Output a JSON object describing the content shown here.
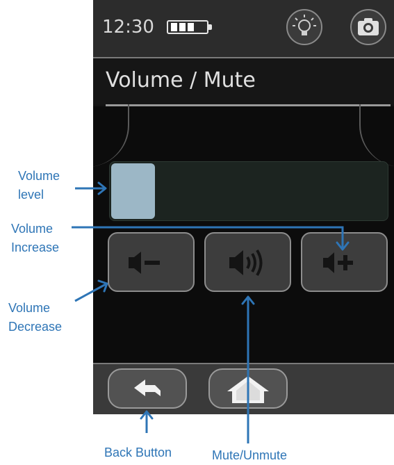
{
  "status_bar": {
    "time": "12:30",
    "battery_icon": "battery-icon",
    "light_icon": "lightbulb-icon",
    "camera_icon": "camera-icon"
  },
  "screen": {
    "title": "Volume / Mute"
  },
  "volume": {
    "level": 0.16
  },
  "buttons": {
    "decrease_icon": "volume-decrease-icon",
    "mute_icon": "speaker-icon",
    "increase_icon": "volume-increase-icon"
  },
  "footer": {
    "back_icon": "back-arrow-icon",
    "home_icon": "home-icon"
  },
  "annotations": {
    "volume_level": "Volume\nlevel",
    "volume_increase": "Volume\nIncrease",
    "volume_decrease": "Volume\nDecrease",
    "back_button": "Back Button",
    "mute_unmute": "Mute/Unmute"
  },
  "colors": {
    "annotation": "#2e75b6",
    "slider_fill": "#9cb7c6"
  }
}
